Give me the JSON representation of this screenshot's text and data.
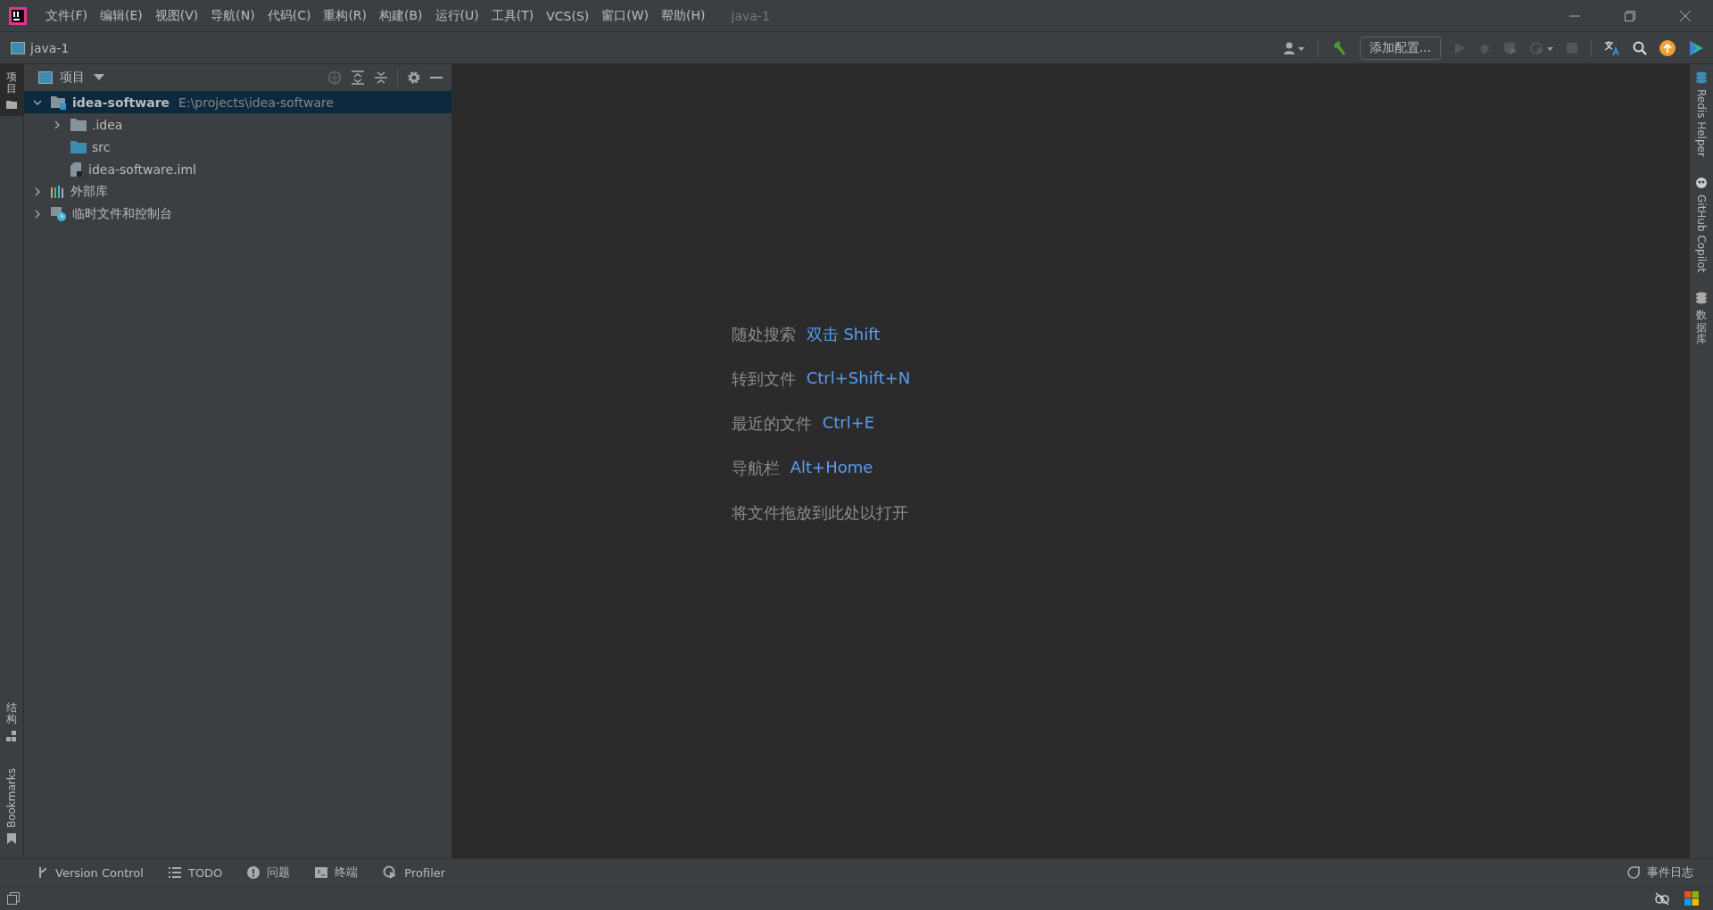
{
  "menu": [
    {
      "label": "文件(F)"
    },
    {
      "label": "编辑(E)"
    },
    {
      "label": "视图(V)"
    },
    {
      "label": "导航(N)"
    },
    {
      "label": "代码(C)"
    },
    {
      "label": "重构(R)"
    },
    {
      "label": "构建(B)"
    },
    {
      "label": "运行(U)"
    },
    {
      "label": "工具(T)"
    },
    {
      "label": "VCS(S)"
    },
    {
      "label": "窗口(W)"
    },
    {
      "label": "帮助(H)"
    }
  ],
  "window": {
    "title": "java-1"
  },
  "navbar": {
    "project": "java-1",
    "config_button": "添加配置..."
  },
  "left_stripe": {
    "top": [
      {
        "label": "项目",
        "kind": "cjk",
        "selected": true
      }
    ],
    "bottom": [
      {
        "label": "结构",
        "kind": "cjk",
        "selected": false
      },
      {
        "label": "Bookmarks",
        "kind": "latin",
        "selected": false
      }
    ]
  },
  "project_panel": {
    "title": "项目",
    "tree": [
      {
        "label": "idea-software",
        "path": "E:\\projects\\idea-software",
        "kind": "module",
        "expanded": true,
        "selected": true,
        "children": [
          {
            "label": ".idea",
            "kind": "folder",
            "expanded": false,
            "selected": false
          },
          {
            "label": "src",
            "kind": "source",
            "selected": false
          },
          {
            "label": "idea-software.iml",
            "kind": "file",
            "selected": false
          }
        ]
      },
      {
        "label": "外部库",
        "kind": "library",
        "expanded": false,
        "selected": false
      },
      {
        "label": "临时文件和控制台",
        "kind": "scratch",
        "expanded": false,
        "selected": false
      }
    ]
  },
  "editor_hints": [
    {
      "label": "随处搜索",
      "shortcut": "双击 Shift"
    },
    {
      "label": "转到文件",
      "shortcut": "Ctrl+Shift+N"
    },
    {
      "label": "最近的文件",
      "shortcut": "Ctrl+E"
    },
    {
      "label": "导航栏",
      "shortcut": "Alt+Home"
    },
    {
      "label": "将文件拖放到此处以打开"
    }
  ],
  "right_stripe": [
    {
      "label": "Redis Helper",
      "kind": "latin"
    },
    {
      "label": "GitHub Copilot",
      "kind": "latin"
    },
    {
      "label": "数据库",
      "kind": "cjk"
    }
  ],
  "tool_windows": [
    {
      "label": "Version Control",
      "kind": "branch"
    },
    {
      "label": "TODO",
      "kind": "list"
    },
    {
      "label": "问题",
      "kind": "problem"
    },
    {
      "label": "终端",
      "kind": "terminal"
    },
    {
      "label": "Profiler",
      "kind": "profiler"
    }
  ],
  "event_log": "事件日志"
}
